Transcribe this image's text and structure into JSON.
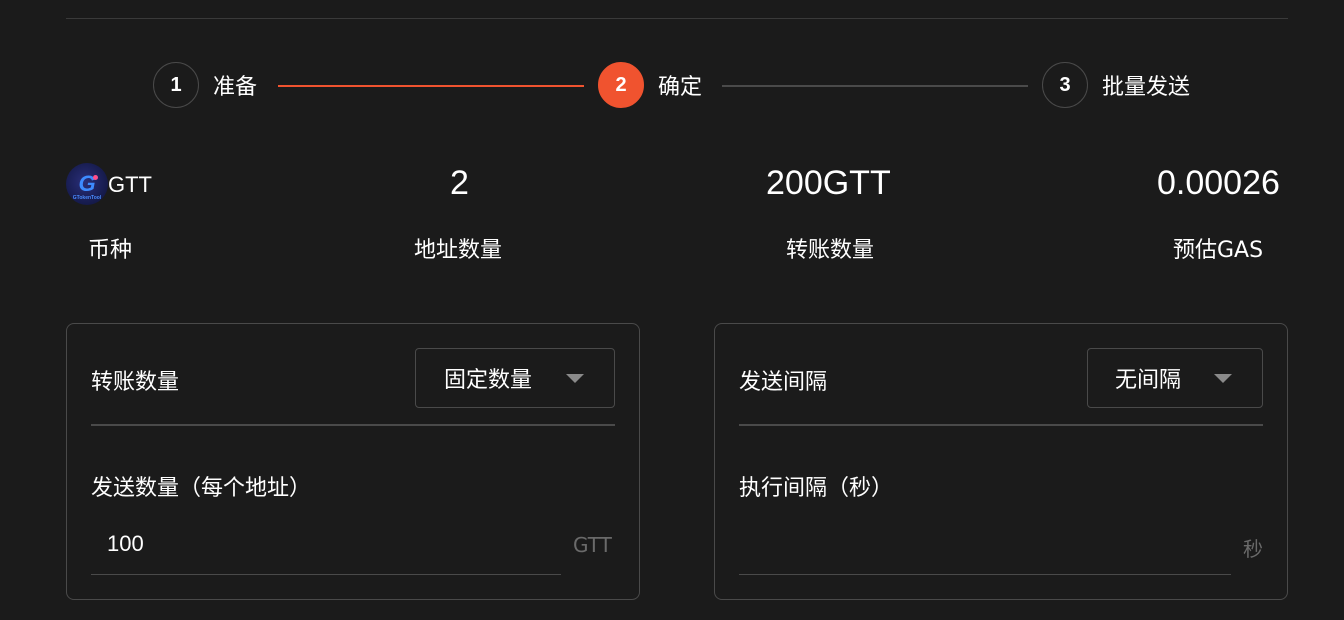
{
  "stepper": {
    "steps": [
      {
        "number": "1",
        "label": "准备",
        "state": "done"
      },
      {
        "number": "2",
        "label": "确定",
        "state": "active"
      },
      {
        "number": "3",
        "label": "批量发送",
        "state": "pending"
      }
    ],
    "accent_color": "#f0532f"
  },
  "summary": {
    "token": {
      "logo_text": "G",
      "logo_caption": "GTokenTool",
      "name": "GTT",
      "label": "币种"
    },
    "address_count": {
      "value": "2",
      "label": "地址数量"
    },
    "transfer_amount": {
      "value": "200GTT",
      "label": "转账数量"
    },
    "estimated_gas": {
      "value": "0.00026",
      "label": "预估GAS"
    }
  },
  "transfer_card": {
    "title": "转账数量",
    "mode_select": {
      "value": "固定数量"
    },
    "field_label": "发送数量（每个地址）",
    "amount_input": {
      "value": "100",
      "unit": "GTT"
    }
  },
  "interval_card": {
    "title": "发送间隔",
    "mode_select": {
      "value": "无间隔"
    },
    "field_label": "执行间隔（秒）",
    "interval_input": {
      "value": "",
      "unit": "秒"
    }
  }
}
